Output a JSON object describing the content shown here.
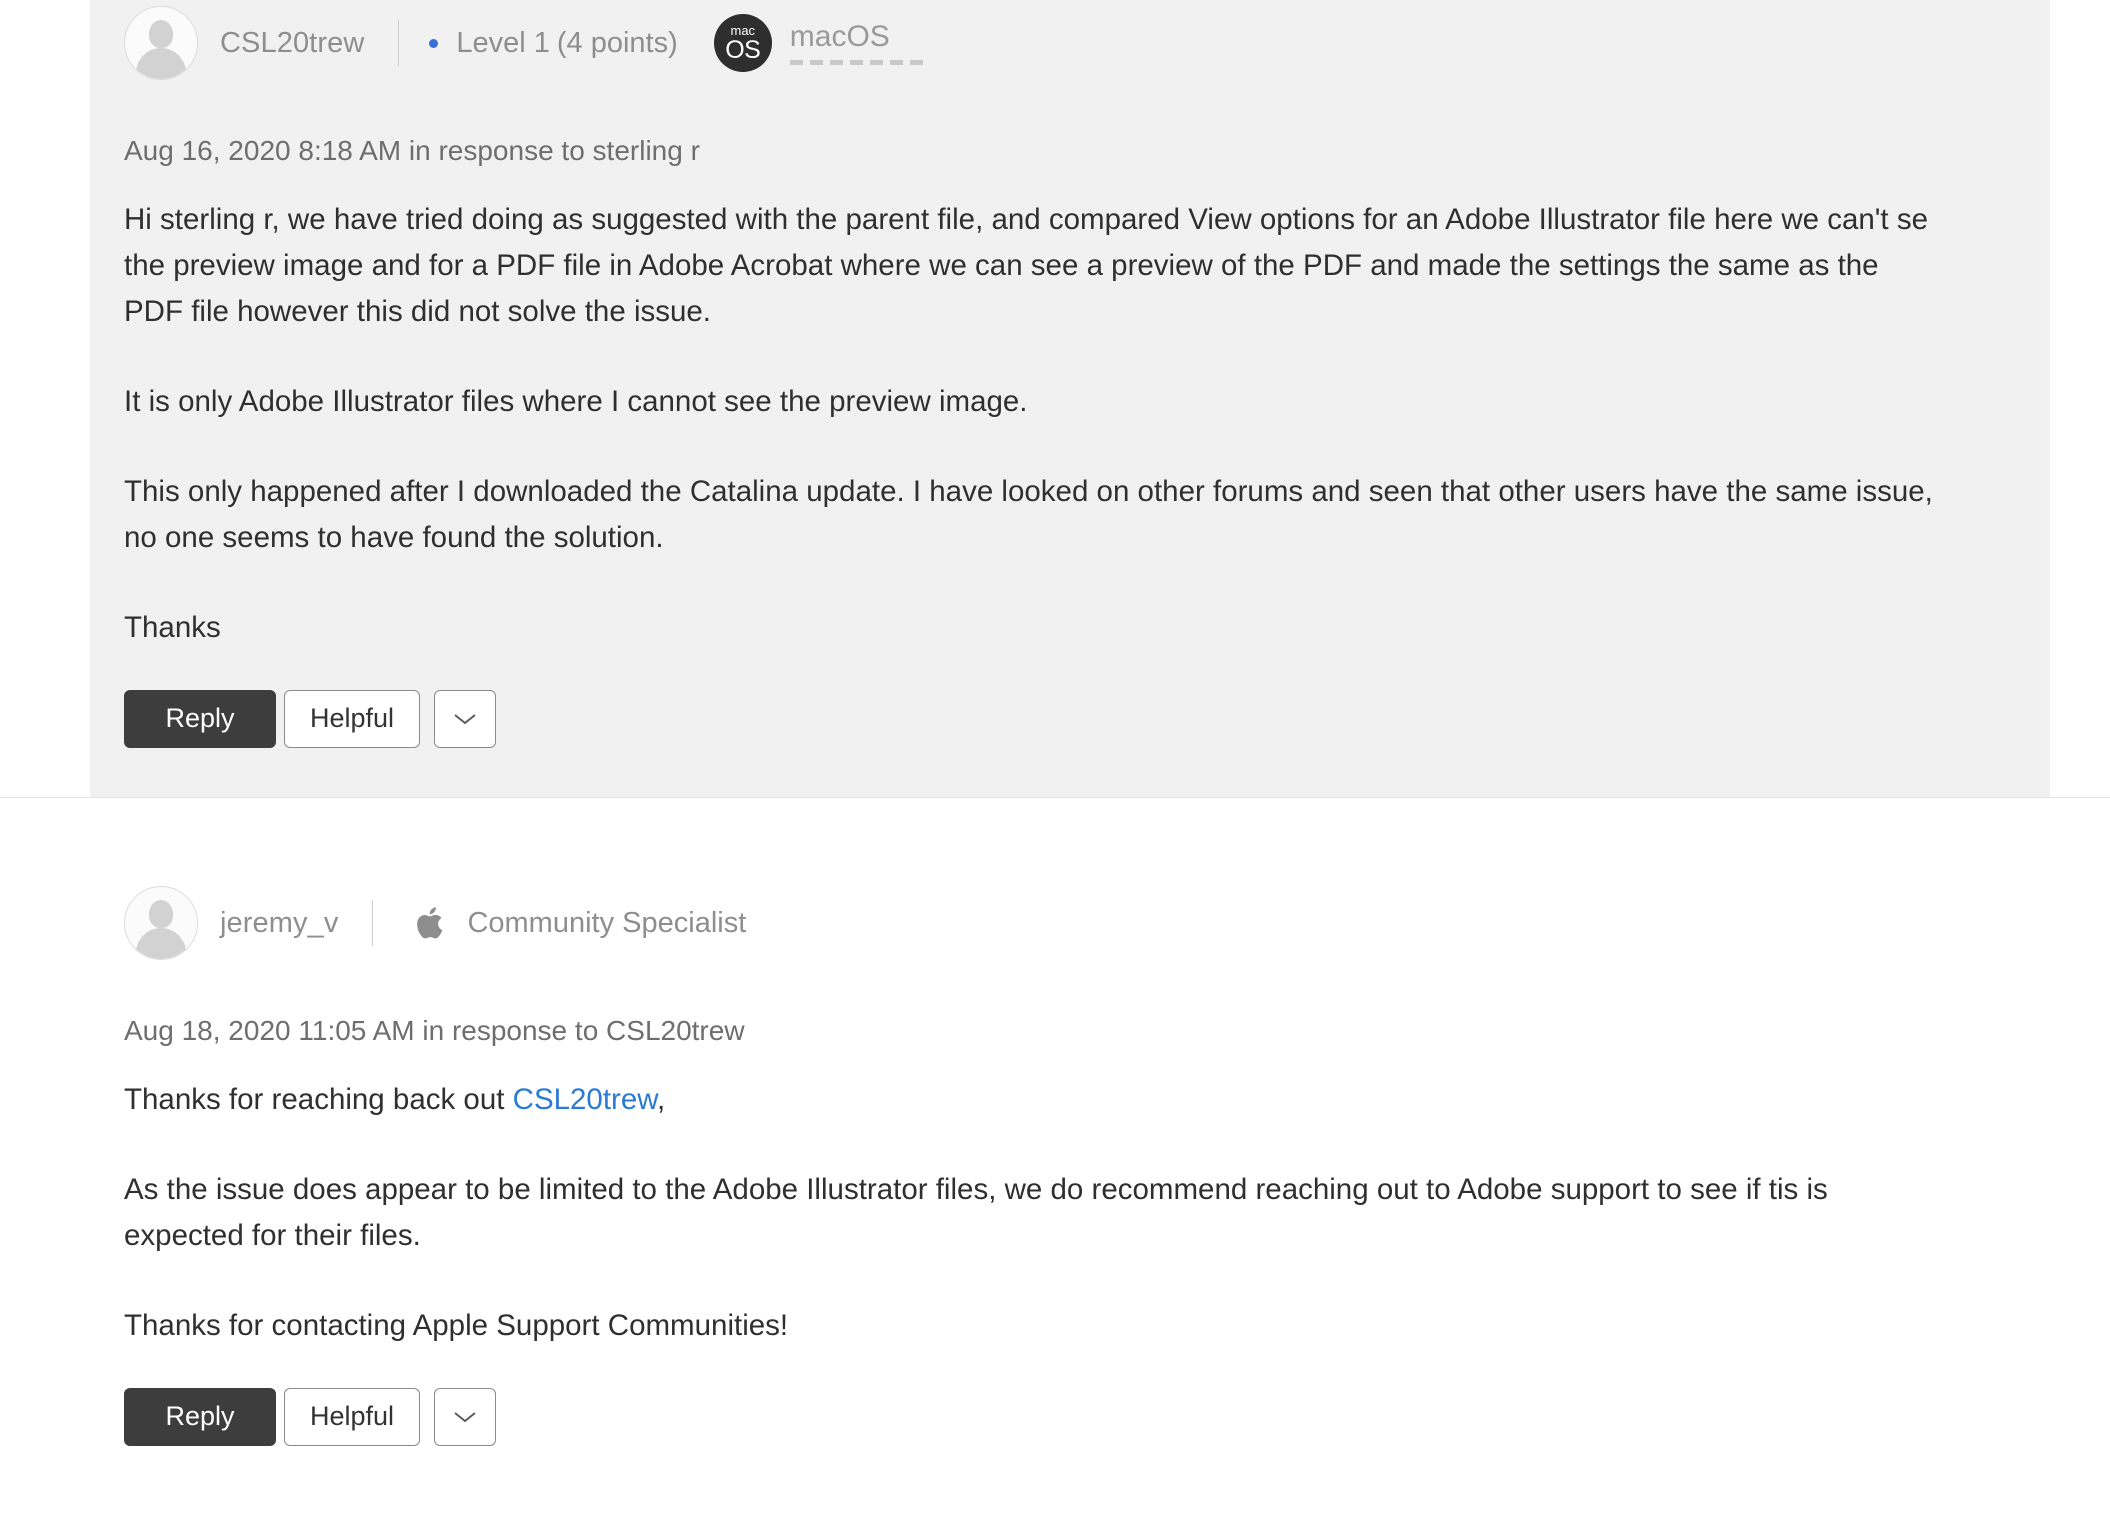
{
  "posts": [
    {
      "author": "CSL20trew",
      "level": "Level 1",
      "points": "(4 points)",
      "os_badge_top": "mac",
      "os_badge_bottom": "OS",
      "os_label": "macOS",
      "timestamp": "Aug 16, 2020 8:18 AM in response to sterling r",
      "paragraphs": [
        "Hi sterling r, we have tried doing as suggested with the parent file, and compared View options for an Adobe Illustrator file here we can't se the preview image and for a PDF file in Adobe Acrobat where we can see a preview of the PDF and made the settings the same as the PDF file however this did not solve the issue.",
        "It is only Adobe Illustrator files where I cannot see the preview image.",
        "This only happened after I downloaded the Catalina update. I have looked on other forums and seen that other users have the same issue, no one seems to have found the solution.",
        "Thanks"
      ],
      "reply_label": "Reply",
      "helpful_label": "Helpful",
      "more_label": "More actions"
    },
    {
      "author": "jeremy_v",
      "role": "Community Specialist",
      "timestamp": "Aug 18, 2020 11:05 AM in response to CSL20trew",
      "para1_before": "Thanks for reaching back out ",
      "para1_link": "CSL20trew",
      "para1_after": ",",
      "paragraphs": [
        "As the issue does appear to be limited to the Adobe Illustrator files, we do recommend reaching out to Adobe support to see if tis is expected for their files.",
        "Thanks for contacting Apple Support Communities!"
      ],
      "reply_label": "Reply",
      "helpful_label": "Helpful",
      "more_label": "More actions"
    }
  ],
  "colors": {
    "post_background": "#f1f1f1",
    "primary_button": "#3d3d3d",
    "link": "#2b7bd4",
    "level_dot": "#3a6fd8",
    "os_badge": "#2e2e2e"
  }
}
